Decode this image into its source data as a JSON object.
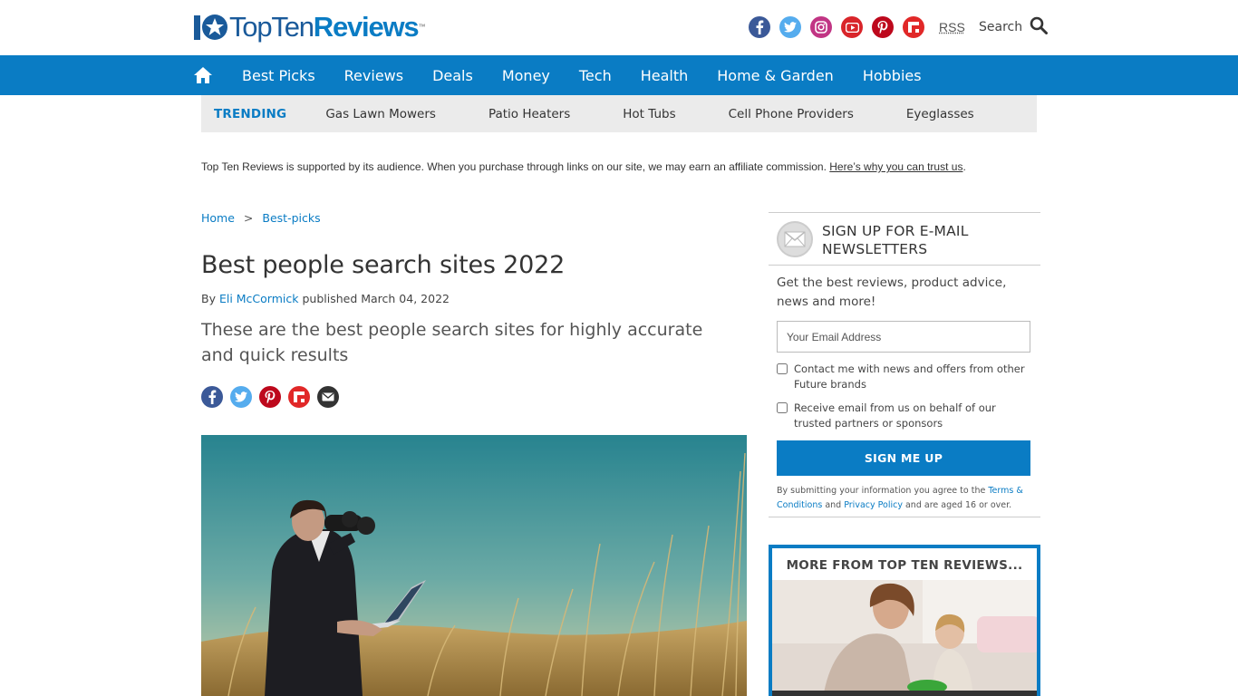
{
  "header": {
    "logo": {
      "mark": "10",
      "top": "Top",
      "ten": "Ten",
      "reviews": "Reviews",
      "tm": "™"
    },
    "socials": [
      {
        "name": "facebook-icon",
        "color": "#3b5998"
      },
      {
        "name": "twitter-icon",
        "color": "#55acee"
      },
      {
        "name": "instagram-icon",
        "color": "#c13584"
      },
      {
        "name": "youtube-icon",
        "color": "#d9252a"
      },
      {
        "name": "pinterest-icon",
        "color": "#bd081c"
      },
      {
        "name": "flipboard-icon",
        "color": "#e12828"
      }
    ],
    "rss_label": "RSS",
    "search_label": "Search"
  },
  "nav": {
    "items": [
      "Best Picks",
      "Reviews",
      "Deals",
      "Money",
      "Tech",
      "Health",
      "Home & Garden",
      "Hobbies"
    ]
  },
  "trending": {
    "label": "TRENDING",
    "items": [
      "Gas Lawn Mowers",
      "Patio Heaters",
      "Hot Tubs",
      "Cell Phone Providers",
      "Eyeglasses"
    ]
  },
  "affiliate": {
    "text": "Top Ten Reviews is supported by its audience. When you purchase through links on our site, we may earn an affiliate commission. ",
    "link": "Here’s why you can trust us",
    "end": "."
  },
  "article": {
    "breadcrumb": [
      "Home",
      "Best-picks"
    ],
    "breadcrumb_sep": ">",
    "title": "Best people search sites 2022",
    "by": "By ",
    "author": "Eli McCormick",
    "published": " published March 04, 2022",
    "strapline": "These are the best people search sites for highly accurate and quick results"
  },
  "newsletter": {
    "title": "SIGN UP FOR E-MAIL NEWSLETTERS",
    "description": "Get the best reviews, product advice, news and more!",
    "email_placeholder": "Your Email Address",
    "check1": "Contact me with news and offers from other Future brands",
    "check2": "Receive email from us on behalf of our trusted partners or sponsors",
    "button": "SIGN ME UP",
    "legal_1": "By submitting your information you agree to the ",
    "legal_terms": "Terms & Conditions",
    "legal_2": " and ",
    "legal_privacy": "Privacy Policy",
    "legal_3": " and are aged 16 or over."
  },
  "more": {
    "title": "MORE FROM TOP TEN REVIEWS..."
  },
  "colors": {
    "brand_blue": "#0a7cc4",
    "trending_bg": "#ebebeb"
  }
}
